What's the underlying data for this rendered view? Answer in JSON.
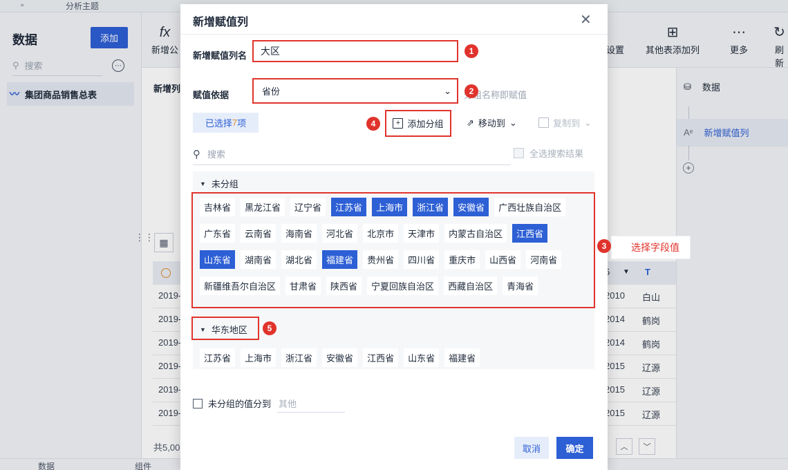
{
  "app": {
    "tab_title": "分析主题",
    "left": {
      "title": "数据",
      "add_label": "添加",
      "search_placeholder": "搜索",
      "dataset": "集团商品销售总表"
    },
    "toolbar": [
      {
        "icon": "fx-icon",
        "glyph": "fx",
        "label": "新增公"
      },
      {
        "icon": "settings-icon",
        "glyph": "",
        "label": "设置"
      },
      {
        "icon": "table-add-icon",
        "glyph": "⊞",
        "label": "其他表添加列"
      },
      {
        "icon": "more-icon",
        "glyph": "⋯",
        "label": "更多"
      },
      {
        "icon": "refresh-icon",
        "glyph": "↻",
        "label": "刷新"
      }
    ],
    "center_label": "新增列",
    "table_rows": [
      {
        "c1": "2019-",
        "c2": "2010",
        "c3": "白山"
      },
      {
        "c1": "2019-",
        "c2": "2014",
        "c3": "鹤岗"
      },
      {
        "c1": "2019-",
        "c2": "2014",
        "c3": "鹤岗"
      },
      {
        "c1": "2019-",
        "c2": "2015",
        "c3": "辽源"
      },
      {
        "c1": "2019-",
        "c2": "2015",
        "c3": "辽源"
      },
      {
        "c1": "2019-",
        "c2": "2015",
        "c3": "辽源"
      }
    ],
    "table_head_e": "5",
    "table_head_t": "T",
    "footer_count": "共5,00",
    "pager_num": "0",
    "bottom_tabs": [
      "数据",
      "组件"
    ],
    "right": {
      "items": [
        "数据",
        "新增赋值列"
      ]
    }
  },
  "dialog": {
    "title": "新增赋值列",
    "name_label": "新增赋值列名",
    "name_value": "大区",
    "basis_label": "赋值依据",
    "basis_value": "省份",
    "basis_hint": "分组名称即赋值",
    "selected_prefix": "已选择",
    "selected_count": "7",
    "selected_suffix": "项",
    "add_group": "添加分组",
    "move_to": "移动到",
    "copy_to": "复制到",
    "search_placeholder": "搜索",
    "select_all": "全选搜索结果",
    "ungrouped_title": "未分组",
    "provinces": [
      [
        {
          "name": "吉林省",
          "selected": false
        },
        {
          "name": "黑龙江省",
          "selected": false
        },
        {
          "name": "辽宁省",
          "selected": false
        },
        {
          "name": "江苏省",
          "selected": true
        },
        {
          "name": "上海市",
          "selected": true
        },
        {
          "name": "浙江省",
          "selected": true
        },
        {
          "name": "安徽省",
          "selected": true
        },
        {
          "name": "广西壮族自治区",
          "selected": false
        }
      ],
      [
        {
          "name": "广东省",
          "selected": false
        },
        {
          "name": "云南省",
          "selected": false
        },
        {
          "name": "海南省",
          "selected": false
        },
        {
          "name": "河北省",
          "selected": false
        },
        {
          "name": "北京市",
          "selected": false
        },
        {
          "name": "天津市",
          "selected": false
        },
        {
          "name": "内蒙古自治区",
          "selected": false
        },
        {
          "name": "江西省",
          "selected": true
        }
      ],
      [
        {
          "name": "山东省",
          "selected": true
        },
        {
          "name": "湖南省",
          "selected": false
        },
        {
          "name": "湖北省",
          "selected": false
        },
        {
          "name": "福建省",
          "selected": true
        },
        {
          "name": "贵州省",
          "selected": false
        },
        {
          "name": "四川省",
          "selected": false
        },
        {
          "name": "重庆市",
          "selected": false
        },
        {
          "name": "山西省",
          "selected": false
        },
        {
          "name": "河南省",
          "selected": false
        }
      ],
      [
        {
          "name": "新疆维吾尔自治区",
          "selected": false
        },
        {
          "name": "甘肃省",
          "selected": false
        },
        {
          "name": "陕西省",
          "selected": false
        },
        {
          "name": "宁夏回族自治区",
          "selected": false
        },
        {
          "name": "西藏自治区",
          "selected": false
        },
        {
          "name": "青海省",
          "selected": false
        }
      ]
    ],
    "group2_title": "华东地区",
    "group2_items": [
      "江苏省",
      "上海市",
      "浙江省",
      "安徽省",
      "江西省",
      "山东省",
      "福建省"
    ],
    "ungrouped_to": "未分组的值分到",
    "other_placeholder": "其他",
    "cancel": "取消",
    "ok": "确定"
  },
  "annotations": {
    "badges": [
      "1",
      "2",
      "3",
      "4",
      "5"
    ],
    "callout_text": "选择字段值"
  },
  "colors": {
    "accent": "#2d5fd5",
    "highlight_red": "#e0332c"
  }
}
